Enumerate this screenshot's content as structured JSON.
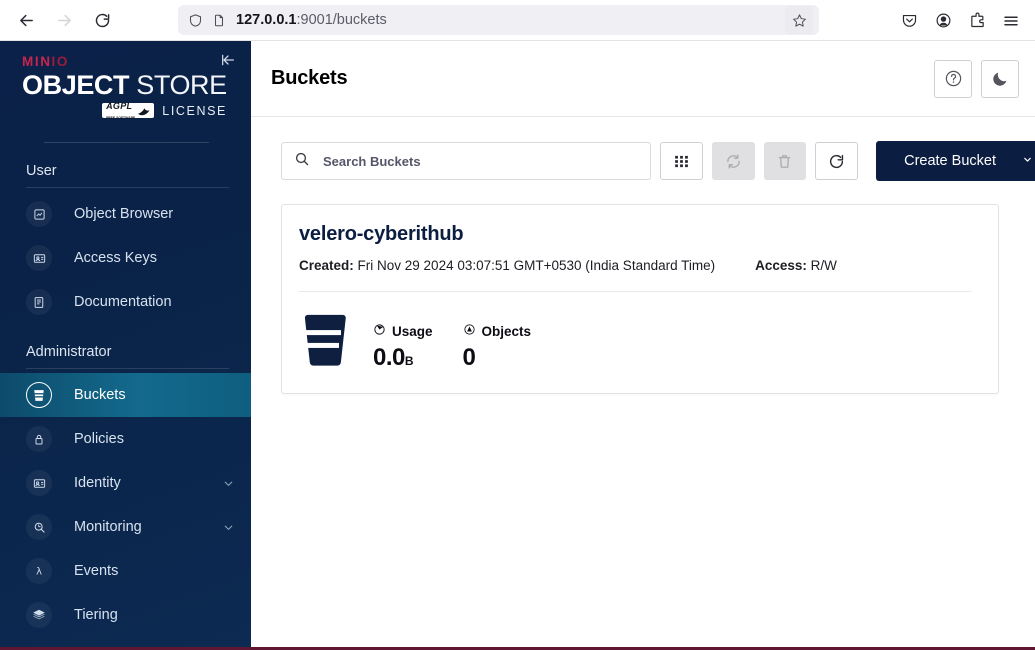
{
  "browser": {
    "back_label": "Back",
    "forward_label": "Forward",
    "reload_label": "Reload",
    "url_host": "127.0.0.1",
    "url_path": ":9001/buckets",
    "bookmark_label": "Bookmark this page",
    "toolbar_icons": [
      "pocket-icon",
      "account-icon",
      "extensions-icon",
      "menu-icon"
    ]
  },
  "sidebar": {
    "logo": {
      "brand": "MIN",
      "brand_suffix": "IO",
      "product_bold": "OBJECT",
      "product_light": "STORE",
      "badge": "AGPL",
      "badge_sub": "FREE SOFTWARE",
      "license_word": "LICENSE"
    },
    "collapse_label": "Collapse sidebar",
    "sections": [
      {
        "label": "User",
        "items": [
          {
            "label": "Object Browser",
            "icon": "object-browser-icon",
            "expandable": false,
            "active": false
          },
          {
            "label": "Access Keys",
            "icon": "access-keys-icon",
            "expandable": false,
            "active": false
          },
          {
            "label": "Documentation",
            "icon": "documentation-icon",
            "expandable": false,
            "active": false
          }
        ]
      },
      {
        "label": "Administrator",
        "items": [
          {
            "label": "Buckets",
            "icon": "bucket-icon",
            "expandable": false,
            "active": true
          },
          {
            "label": "Policies",
            "icon": "policies-icon",
            "expandable": false,
            "active": false
          },
          {
            "label": "Identity",
            "icon": "identity-icon",
            "expandable": true,
            "active": false
          },
          {
            "label": "Monitoring",
            "icon": "monitoring-icon",
            "expandable": true,
            "active": false
          },
          {
            "label": "Events",
            "icon": "events-lambda-icon",
            "expandable": false,
            "active": false
          },
          {
            "label": "Tiering",
            "icon": "tiering-icon",
            "expandable": false,
            "active": false
          }
        ]
      }
    ]
  },
  "header": {
    "title": "Buckets",
    "help_label": "Help",
    "theme_label": "Dark mode"
  },
  "toolbar": {
    "search_placeholder": "Search Buckets",
    "search_value": "",
    "grid_view_label": "Grid view",
    "sync_label": "Replication",
    "delete_label": "Delete selected",
    "refresh_label": "Refresh",
    "create_label": "Create Bucket"
  },
  "buckets": [
    {
      "name": "velero-cyberithub",
      "created_label": "Created:",
      "created_value": "Fri Nov 29 2024 03:07:51 GMT+0530 (India Standard Time)",
      "access_label": "Access:",
      "access_value": "R/W",
      "usage_label": "Usage",
      "usage_value": "0.0",
      "usage_unit": "B",
      "objects_label": "Objects",
      "objects_value": "0"
    }
  ],
  "colors": {
    "sidebar_bg": "#0b2149",
    "active_nav": "#136a8c",
    "brand_red": "#c7254e",
    "navy": "#0b1d40",
    "bottom_strip": "#5e1633"
  }
}
